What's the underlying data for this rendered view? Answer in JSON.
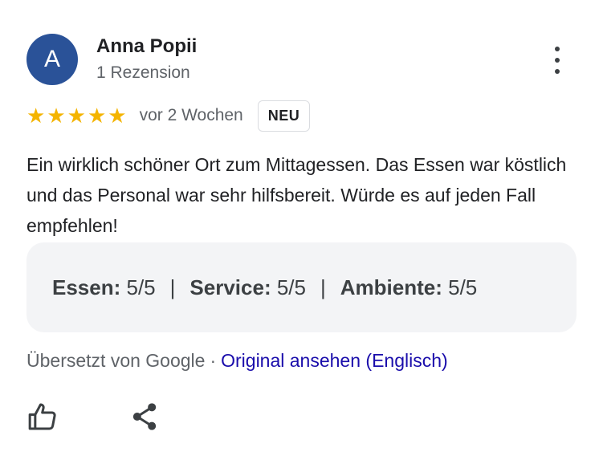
{
  "author": {
    "avatar_letter": "A",
    "avatar_color": "#2a5298",
    "name": "Anna Popii",
    "meta": "1 Rezension"
  },
  "review": {
    "stars": 5,
    "stars_text": "★★★★★",
    "date": "vor 2 Wochen",
    "badge": "NEU",
    "text": "Ein wirklich schöner Ort zum Mittagessen. Das Essen war köstlich und das Personal war sehr hilfsbereit. Würde es auf jeden Fall empfehlen!"
  },
  "ratings": [
    {
      "label": "Essen:",
      "value": "5/5"
    },
    {
      "label": "Service:",
      "value": "5/5"
    },
    {
      "label": "Ambiente:",
      "value": "5/5"
    }
  ],
  "ratings_separator": "|",
  "translation": {
    "note": "Übersetzt von Google",
    "separator": "·",
    "link": "Original ansehen (Englisch)"
  },
  "actions": {
    "like_icon": "thumbs-up-icon",
    "share_icon": "share-icon",
    "more_icon": "more-vert-icon"
  },
  "colors": {
    "star": "#f4b400",
    "link": "#1a0dab",
    "ratings_bg": "#f3f4f6"
  }
}
